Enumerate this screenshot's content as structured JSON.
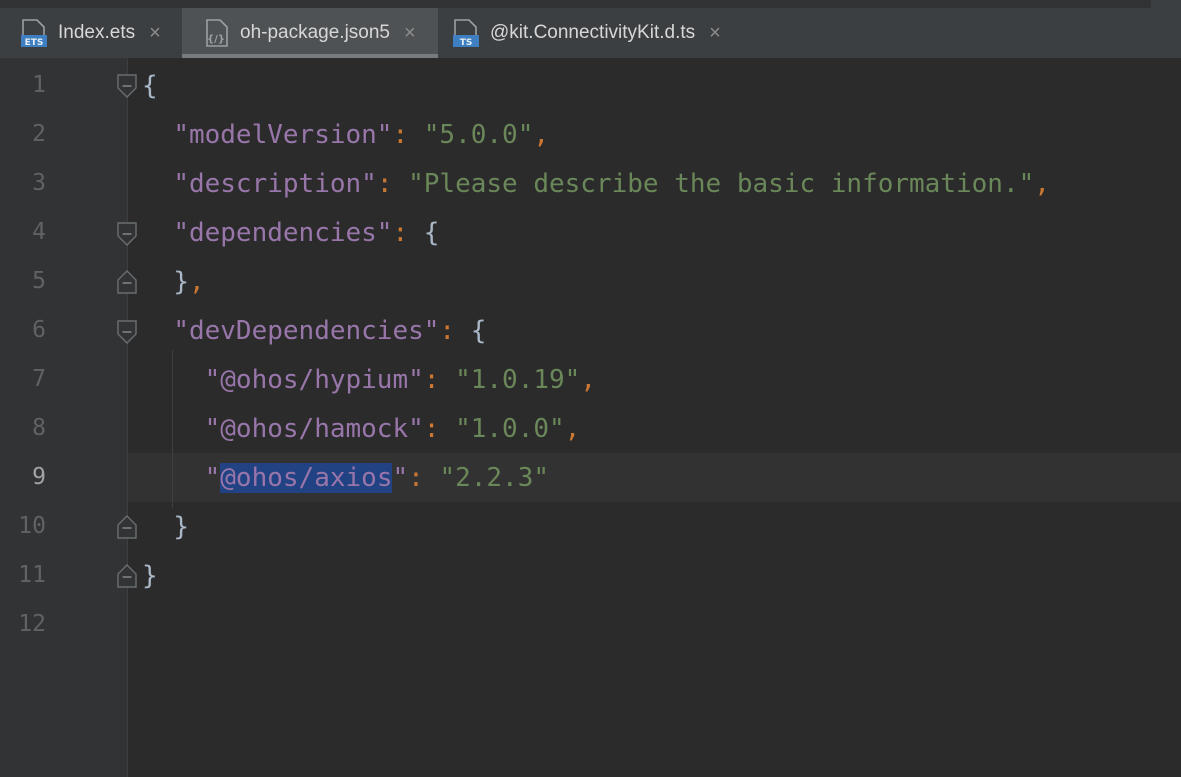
{
  "tabs": [
    {
      "label": "Index.ets",
      "icon": "ets-file-icon",
      "active": false
    },
    {
      "label": "oh-package.json5",
      "icon": "json5-file-icon",
      "active": true
    },
    {
      "label": "@kit.ConnectivityKit.d.ts",
      "icon": "ts-file-icon",
      "active": false
    }
  ],
  "icon_badges": {
    "ets": "ETS",
    "ts": "TS",
    "json": "{/}"
  },
  "close_glyph": "×",
  "colors": {
    "background": "#2b2b2b",
    "gutter": "#313335",
    "json_key": "#9876aa",
    "json_string": "#6a8759",
    "punctuation": "#cc7832",
    "selection": "#214283"
  },
  "editor": {
    "current_line": 9,
    "selected_text": "@ohos/axios",
    "line_numbers": [
      "1",
      "2",
      "3",
      "4",
      "5",
      "6",
      "7",
      "8",
      "9",
      "10",
      "11",
      "12"
    ],
    "lines": {
      "l1": {
        "brace": "{"
      },
      "l2": {
        "key": "\"modelVersion\"",
        "colon": ":",
        "value": "\"5.0.0\"",
        "comma": ","
      },
      "l3": {
        "key": "\"description\"",
        "colon": ":",
        "value": "\"Please describe the basic information.\"",
        "comma": ","
      },
      "l4": {
        "key": "\"dependencies\"",
        "colon": ":",
        "brace": "{"
      },
      "l5": {
        "brace": "}",
        "comma": ","
      },
      "l6": {
        "key": "\"devDependencies\"",
        "colon": ":",
        "brace": "{"
      },
      "l7": {
        "key": "\"@ohos/hypium\"",
        "colon": ":",
        "value": "\"1.0.19\"",
        "comma": ","
      },
      "l8": {
        "key": "\"@ohos/hamock\"",
        "colon": ":",
        "value": "\"1.0.0\"",
        "comma": ","
      },
      "l9": {
        "quote_open": "\"",
        "key_selected": "@ohos/axios",
        "quote_close": "\"",
        "colon": ":",
        "value": "\"2.2.3\""
      },
      "l10": {
        "brace": "}"
      },
      "l11": {
        "brace": "}"
      }
    }
  }
}
